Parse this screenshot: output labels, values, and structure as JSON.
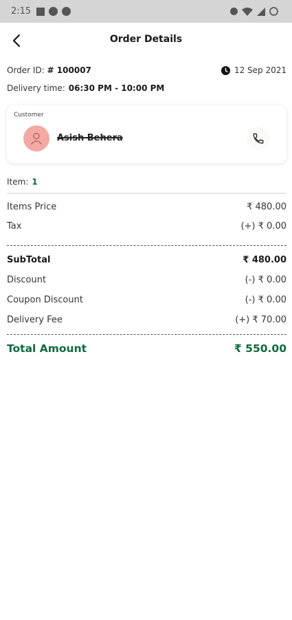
{
  "status_bar": {
    "time": "2:15"
  },
  "header": {
    "title": "Order Details"
  },
  "order": {
    "id_label": "Order ID:",
    "id_value": "# 100007",
    "date": "12 Sep 2021",
    "delivery_label": "Delivery time:",
    "delivery_value": "06:30 PM - 10:00 PM"
  },
  "customer": {
    "label": "Customer",
    "name": "Asish Behera"
  },
  "items": {
    "label": "Item:",
    "count": "1"
  },
  "prices": {
    "items_price_label": "Items Price",
    "items_price": "₹ 480.00",
    "tax_label": "Tax",
    "tax": "(+) ₹ 0.00",
    "subtotal_label": "SubTotal",
    "subtotal": "₹ 480.00",
    "discount_label": "Discount",
    "discount": "(-) ₹ 0.00",
    "coupon_label": "Coupon Discount",
    "coupon": "(-) ₹ 0.00",
    "delivery_fee_label": "Delivery Fee",
    "delivery_fee": "(+) ₹ 70.00",
    "total_label": "Total Amount",
    "total": "₹ 550.00"
  },
  "colors": {
    "accent": "#0f6a3d",
    "avatar_bg": "#f3a9a4",
    "status_bar": "#d5d5d5"
  },
  "icons": [
    "back-arrow-icon",
    "clock-icon",
    "user-icon",
    "phone-icon",
    "wifi-icon",
    "signal-icon",
    "battery-icon"
  ]
}
